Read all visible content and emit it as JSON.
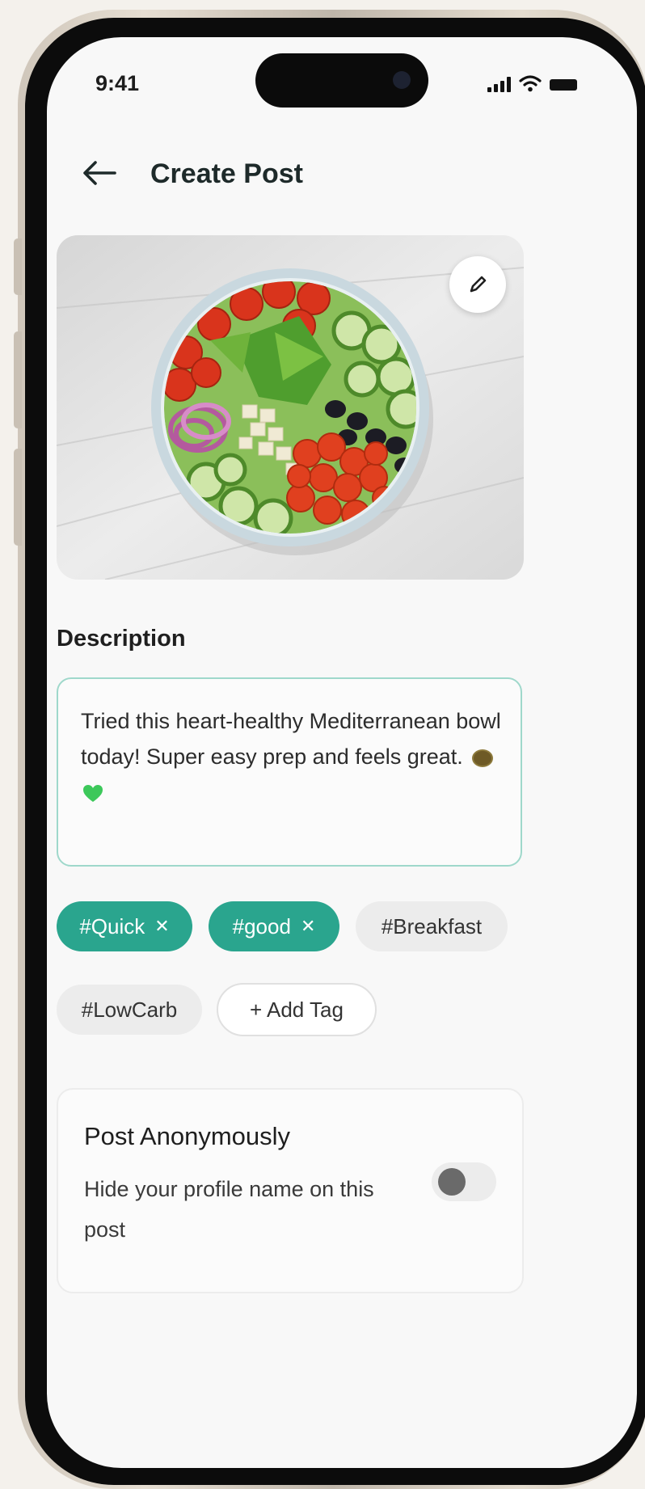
{
  "status_bar": {
    "time": "9:41"
  },
  "header": {
    "title": "Create Post",
    "back_icon": "arrow-left-icon"
  },
  "photo": {
    "alt": "Mediterranean salad bowl",
    "edit_icon": "pencil-icon"
  },
  "description": {
    "label": "Description",
    "value": "Tried this heart-healthy Mediterranean bowl today! Super easy prep and feels great."
  },
  "tags": [
    {
      "label": "#Quick",
      "selected": true
    },
    {
      "label": "#good",
      "selected": true
    },
    {
      "label": "#Breakfast",
      "selected": false
    },
    {
      "label": "#LowCarb",
      "selected": false
    }
  ],
  "add_tag_label": "+ Add Tag",
  "tag_remove_glyph": "✕",
  "anonymous": {
    "title": "Post Anonymously",
    "subtitle": "Hide your profile name on this post",
    "enabled": false
  },
  "colors": {
    "accent": "#2aa58e",
    "border": "#9fd8cb"
  }
}
